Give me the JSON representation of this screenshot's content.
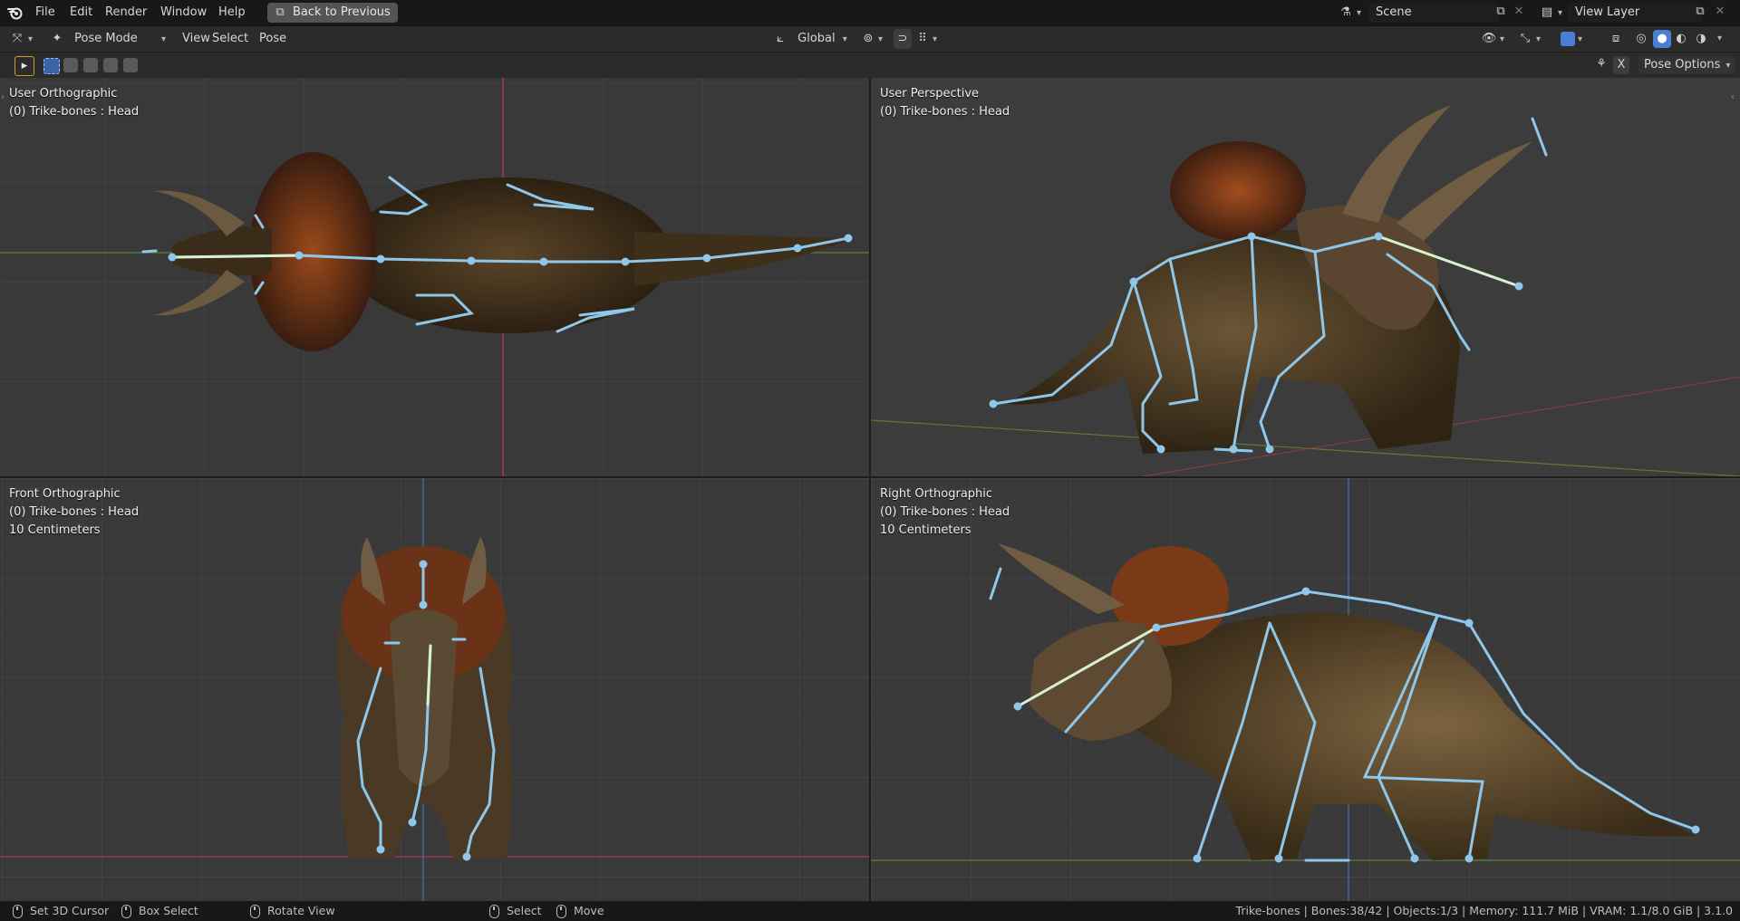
{
  "topbar": {
    "menu": [
      "File",
      "Edit",
      "Render",
      "Window",
      "Help"
    ],
    "back_button": "Back to Previous",
    "scene": "Scene",
    "view_layer": "View Layer"
  },
  "header": {
    "mode": "Pose Mode",
    "menus": [
      "View",
      "Select",
      "Pose"
    ],
    "orientation": "Global",
    "pose_options": "Pose Options",
    "x_mirror": "X"
  },
  "viewports": {
    "top_left": {
      "view": "User Orthographic",
      "object": "(0) Trike-bones : Head"
    },
    "top_right": {
      "view": "User Perspective",
      "object": "(0) Trike-bones : Head"
    },
    "bottom_left": {
      "view": "Front Orthographic",
      "object": "(0) Trike-bones : Head",
      "scale": "10 Centimeters"
    },
    "bottom_right": {
      "view": "Right Orthographic",
      "object": "(0) Trike-bones : Head",
      "scale": "10 Centimeters"
    }
  },
  "statusbar": {
    "left": [
      "Set 3D Cursor",
      "Box Select",
      "Rotate View",
      "Select",
      "Move"
    ],
    "stats": "Trike-bones | Bones:38/42 | Objects:1/3 | Memory: 111.7 MiB | VRAM: 1.1/8.0 GiB | 3.1.0"
  },
  "colors": {
    "accent_blue": "#4a7fd6",
    "bone_blue": "#8ec7ea",
    "bone_active": "#d6f0d0",
    "axis_red": "#b8455a",
    "axis_green": "#6f8f3a",
    "axis_blue": "#3f76b5"
  },
  "icons": {
    "blender_logo": "blender-logo-icon",
    "editor_type": "3d-viewport-icon",
    "mode": "pose-mode-icon",
    "select_box": "select-box-icon"
  }
}
